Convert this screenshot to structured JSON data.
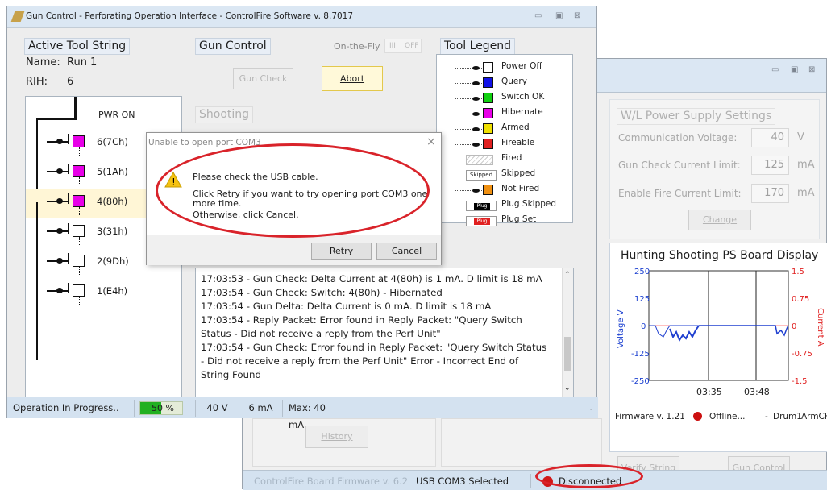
{
  "main_window": {
    "title": "Gun Control - Perforating Operation Interface - ControlFire Software v. 8.7017"
  },
  "active_tool": {
    "title": "Active Tool String",
    "name_label": "Name:",
    "name_value": "Run 1",
    "rih_label": "RIH:",
    "rih_value": "6",
    "pwr_on": "PWR ON",
    "switches": [
      {
        "label": "6(7Ch)",
        "color": "#e800e8",
        "highlight": false
      },
      {
        "label": "5(1Ah)",
        "color": "#e800e8",
        "highlight": false
      },
      {
        "label": "4(80h)",
        "color": "#e800e8",
        "highlight": true
      },
      {
        "label": "3(31h)",
        "color": "#ffffff",
        "highlight": false
      },
      {
        "label": "2(9Dh)",
        "color": "#ffffff",
        "highlight": false
      },
      {
        "label": "1(E4h)",
        "color": "#ffffff",
        "highlight": false
      }
    ]
  },
  "gun_control": {
    "title": "Gun Control",
    "on_the_fly": "On-the-Fly",
    "toggle_on": "III",
    "toggle_off": "OFF",
    "gun_check": "Gun Check",
    "abort": "Abort",
    "shooting": "Shooting"
  },
  "legend": {
    "title": "Tool Legend",
    "items": [
      {
        "label": "Power Off",
        "icon": "switch-off",
        "color": "#ffffff"
      },
      {
        "label": "Query",
        "icon": "switch",
        "color": "#1010e8"
      },
      {
        "label": "Switch OK",
        "icon": "switch",
        "color": "#10d010"
      },
      {
        "label": "Hibernate",
        "icon": "switch",
        "color": "#e800e8"
      },
      {
        "label": "Armed",
        "icon": "switch",
        "color": "#f0e000"
      },
      {
        "label": "Fireable",
        "icon": "switch",
        "color": "#e02020"
      },
      {
        "label": "Fired",
        "icon": "hatched",
        "color": "#d0d0d0"
      },
      {
        "label": "Skipped",
        "icon": "tag",
        "color": "#ffffff",
        "tag": "Skipped"
      },
      {
        "label": "Not Fired",
        "icon": "switch",
        "color": "#f09010"
      },
      {
        "label": "Plug Skipped",
        "icon": "plug",
        "color": "#000000",
        "tag": "Plug"
      },
      {
        "label": "Plug Set",
        "icon": "plug",
        "color": "#e02020",
        "tag": "Plug"
      }
    ]
  },
  "log": {
    "lines": [
      "17:03:53 - Gun Check: Delta Current at 4(80h) is 1 mA. D limit is 18 mA",
      "17:03:54 - Gun Check: Switch: 4(80h) - Hibernated",
      "17:03:54 - Gun Delta: Delta Current is 0 mA. D limit is 18 mA",
      "17:03:54 - Reply Packet: Error found in Reply Packet: \"Query Switch Status - Did not receive a reply from the Perf Unit\"",
      "17:03:54 - Gun Check: Error found in Reply Packet: \"Query Switch Status - Did not receive a reply from the Perf Unit\" Error - Incorrect End of String Found"
    ]
  },
  "status_main": {
    "operation": "Operation In Progress..",
    "progress_text": "50 %",
    "progress": 0.5,
    "voltage": "40 V",
    "current": "6 mA",
    "max": "Max: 40 mA"
  },
  "dialog": {
    "title": "Unable to open port COM3",
    "line1": "Please check the USB cable.",
    "line2": "Click Retry if you want to try opening port COM3 one more time.",
    "line3": "Otherwise, click Cancel.",
    "retry": "Retry",
    "cancel": "Cancel"
  },
  "ps_settings": {
    "title": "W/L Power Supply Settings",
    "comm_label": "Communication Voltage:",
    "comm_value": "40",
    "comm_unit": "V",
    "gc_label": "Gun Check Current Limit:",
    "gc_value": "125",
    "gc_unit": "mA",
    "ef_label": "Enable Fire Current Limit:",
    "ef_value": "170",
    "ef_unit": "mA",
    "change": "Change"
  },
  "hunting": {
    "title": "Hunting Shooting PS Board Display",
    "firmware": "Firmware v. 1.21",
    "offline": "Offline...",
    "dash": "-",
    "drum": "Drum1",
    "arm": "ArmCF",
    "verify": "Verify String",
    "gun_control": "Gun Control"
  },
  "bottom": {
    "history": "History",
    "board_fw": "ControlFire Board Firmware v. 6.2",
    "usb": "USB COM3 Selected",
    "disconnected": "Disconnected"
  },
  "chart_data": {
    "type": "line",
    "ylabel": "Voltage V",
    "y2label": "Current A",
    "ylim": [
      -250,
      250
    ],
    "y2lim": [
      -1.5,
      1.5
    ],
    "yticks": [
      "250",
      "125",
      "0",
      "-125",
      "-250"
    ],
    "y2ticks": [
      "1.5",
      "0.75",
      "0",
      "-0.75",
      "-1.5"
    ],
    "xticks": [
      "03:35",
      "03:48"
    ],
    "series": [
      {
        "name": "Voltage",
        "color": "#2040d0"
      },
      {
        "name": "Current",
        "color": "#e02020"
      }
    ]
  }
}
